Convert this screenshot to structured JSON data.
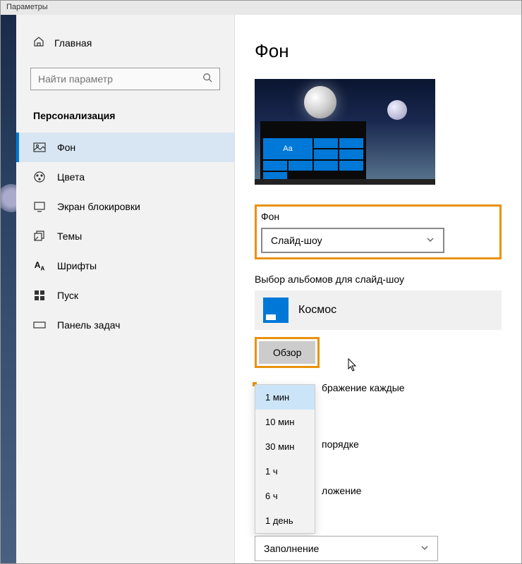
{
  "window_title": "Параметры",
  "sidebar": {
    "home": "Главная",
    "search_placeholder": "Найти параметр",
    "section": "Персонализация",
    "items": [
      {
        "label": "Фон",
        "icon": "image-icon",
        "active": true
      },
      {
        "label": "Цвета",
        "icon": "palette-icon",
        "active": false
      },
      {
        "label": "Экран блокировки",
        "icon": "lock-screen-icon",
        "active": false
      },
      {
        "label": "Темы",
        "icon": "themes-icon",
        "active": false
      },
      {
        "label": "Шрифты",
        "icon": "fonts-icon",
        "active": false
      },
      {
        "label": "Пуск",
        "icon": "start-icon",
        "active": false
      },
      {
        "label": "Панель задач",
        "icon": "taskbar-icon",
        "active": false
      }
    ]
  },
  "content": {
    "title": "Фон",
    "preview_tile_text": "Aa",
    "background_label": "Фон",
    "background_value": "Слайд-шоу",
    "album_label": "Выбор альбомов для слайд-шоу",
    "album_name": "Космос",
    "browse_label": "Обзор",
    "interval_label_partial": "бражение каждые",
    "shuffle_label_partial": "порядке",
    "fit_label_partial": "ложение",
    "fit_value": "Заполнение",
    "interval_options": [
      "1 мин",
      "10 мин",
      "30 мин",
      "1 ч",
      "6 ч",
      "1 день"
    ],
    "interval_selected": "1 мин"
  }
}
